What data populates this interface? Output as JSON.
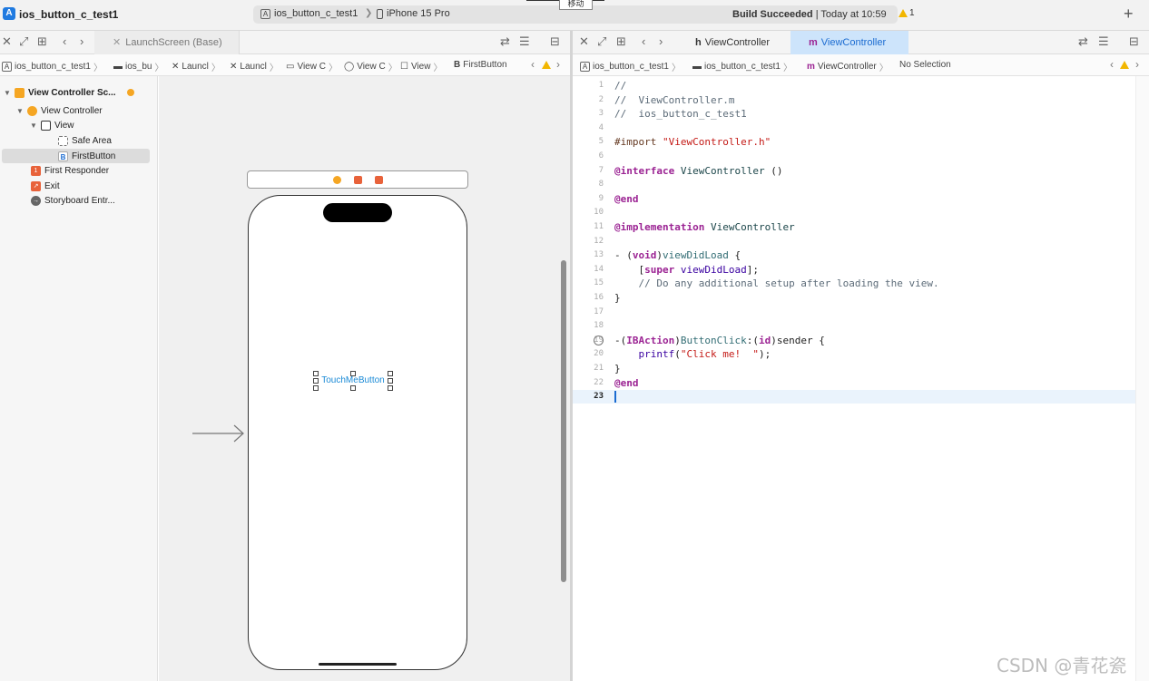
{
  "window": {
    "project_title": "ios_button_c_test1",
    "scheme": "ios_button_c_test1",
    "device": "iPhone 15 Pro",
    "build_status_bold": "Build Succeeded",
    "build_status_rest": " | Today at 10:59",
    "warning_count": "1",
    "tooltip": "移动"
  },
  "left_tabs": {
    "tab_label": "LaunchScreen (Base)"
  },
  "right_tabs": {
    "tab_h": "ViewController",
    "tab_m": "ViewController",
    "glyph_h": "h",
    "glyph_m": "m"
  },
  "left_jumpbar": [
    "ios_button_c_test1",
    "ios_bu",
    "Launcl",
    "Launcl",
    "View C",
    "View C",
    "View",
    "FirstButton"
  ],
  "right_jumpbar": [
    "ios_button_c_test1",
    "ios_button_c_test1",
    "ViewController",
    "No Selection"
  ],
  "outline": {
    "scene": "View Controller Sc...",
    "view_controller": "View Controller",
    "view": "View",
    "safe_area": "Safe Area",
    "first_button": "FirstButton",
    "first_responder": "First Responder",
    "exit": "Exit",
    "storyboard_entry": "Storyboard Entr..."
  },
  "canvas": {
    "button_title": "TouchMeButton"
  },
  "code_lines": [
    {
      "n": "1",
      "html": "<span class='tk-com'>//</span>"
    },
    {
      "n": "2",
      "html": "<span class='tk-com'>//  ViewController.m</span>"
    },
    {
      "n": "3",
      "html": "<span class='tk-com'>//  ios_button_c_test1</span>"
    },
    {
      "n": "4",
      "html": ""
    },
    {
      "n": "5",
      "html": "<span class='tk-pp'>#import </span><span class='tk-str'>\"ViewController.h\"</span>"
    },
    {
      "n": "6",
      "html": ""
    },
    {
      "n": "7",
      "html": "<span class='tk-kw'>@interface</span> <span class='tk-cls'>ViewController</span> ()"
    },
    {
      "n": "8",
      "html": ""
    },
    {
      "n": "9",
      "html": "<span class='tk-kw'>@end</span>"
    },
    {
      "n": "10",
      "html": ""
    },
    {
      "n": "11",
      "html": "<span class='tk-kw'>@implementation</span> <span class='tk-cls'>ViewController</span>"
    },
    {
      "n": "12",
      "html": ""
    },
    {
      "n": "13",
      "html": "- (<span class='tk-kw'>void</span>)<span class='tk-fn'>viewDidLoad</span> {"
    },
    {
      "n": "14",
      "html": "    [<span class='tk-kw'>super</span> <span class='tk-sys'>viewDidLoad</span>];"
    },
    {
      "n": "15",
      "html": "    <span class='tk-com'>// Do any additional setup after loading the view.</span>"
    },
    {
      "n": "16",
      "html": "}"
    },
    {
      "n": "17",
      "html": ""
    },
    {
      "n": "18",
      "html": ""
    },
    {
      "n": "19",
      "html": "-(<span class='tk-kw'>IBAction</span>)<span class='tk-fn'>ButtonClick</span>:(<span class='tk-kw'>id</span>)sender {"
    },
    {
      "n": "20",
      "html": "    <span class='tk-sys'>printf</span>(<span class='tk-str'>\"Click me!  \"</span>);"
    },
    {
      "n": "21",
      "html": "}"
    },
    {
      "n": "22",
      "html": "<span class='tk-kw'>@end</span>"
    },
    {
      "n": "23",
      "html": ""
    }
  ],
  "watermark": "CSDN @青花瓷"
}
